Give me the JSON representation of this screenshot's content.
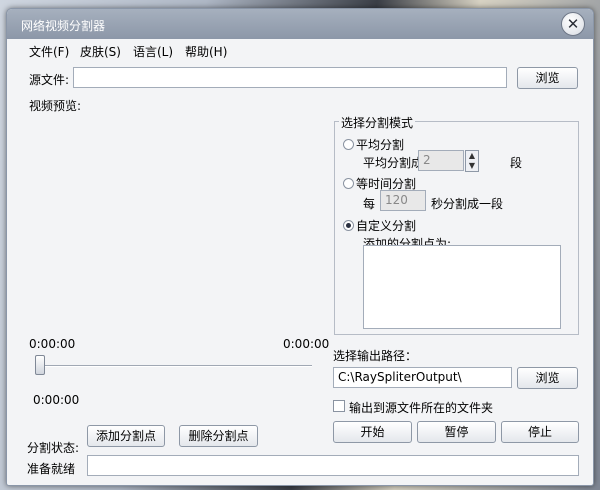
{
  "window": {
    "title": "网络视频分割器"
  },
  "menu": [
    {
      "label": "文件(F)"
    },
    {
      "label": "皮肤(S)"
    },
    {
      "label": "语言(L)"
    },
    {
      "label": "帮助(H)"
    }
  ],
  "source": {
    "label": "源文件:",
    "value": "",
    "browse_label": "浏览"
  },
  "preview": {
    "label": "视频预览:"
  },
  "split_mode": {
    "title": "选择分割模式",
    "average": {
      "label": "平均分割",
      "desc_prefix": "平均分割成",
      "value": "2",
      "unit": "段",
      "selected": false
    },
    "time": {
      "label": "等时间分割",
      "prefix": "每",
      "value": "120",
      "suffix": "秒分割成一段",
      "selected": false
    },
    "custom": {
      "label": "自定义分割",
      "points_label": "添加的分割点为:",
      "selected": true
    }
  },
  "timeline": {
    "start_time": "0:00:00",
    "end_time": "0:00:00",
    "current_time": "0:00:00"
  },
  "output": {
    "label": "选择输出路径：",
    "path": "C:\\RaySpliterOutput\\",
    "browse_label": "浏览",
    "same_folder_label": "输出到源文件所在的文件夹",
    "same_folder_checked": false
  },
  "actions": {
    "add_point": "添加分割点",
    "delete_point": "删除分割点",
    "start": "开始",
    "pause": "暂停",
    "stop": "停止"
  },
  "status": {
    "label": "分割状态:",
    "ready_label": "准备就绪",
    "progress": 0
  }
}
